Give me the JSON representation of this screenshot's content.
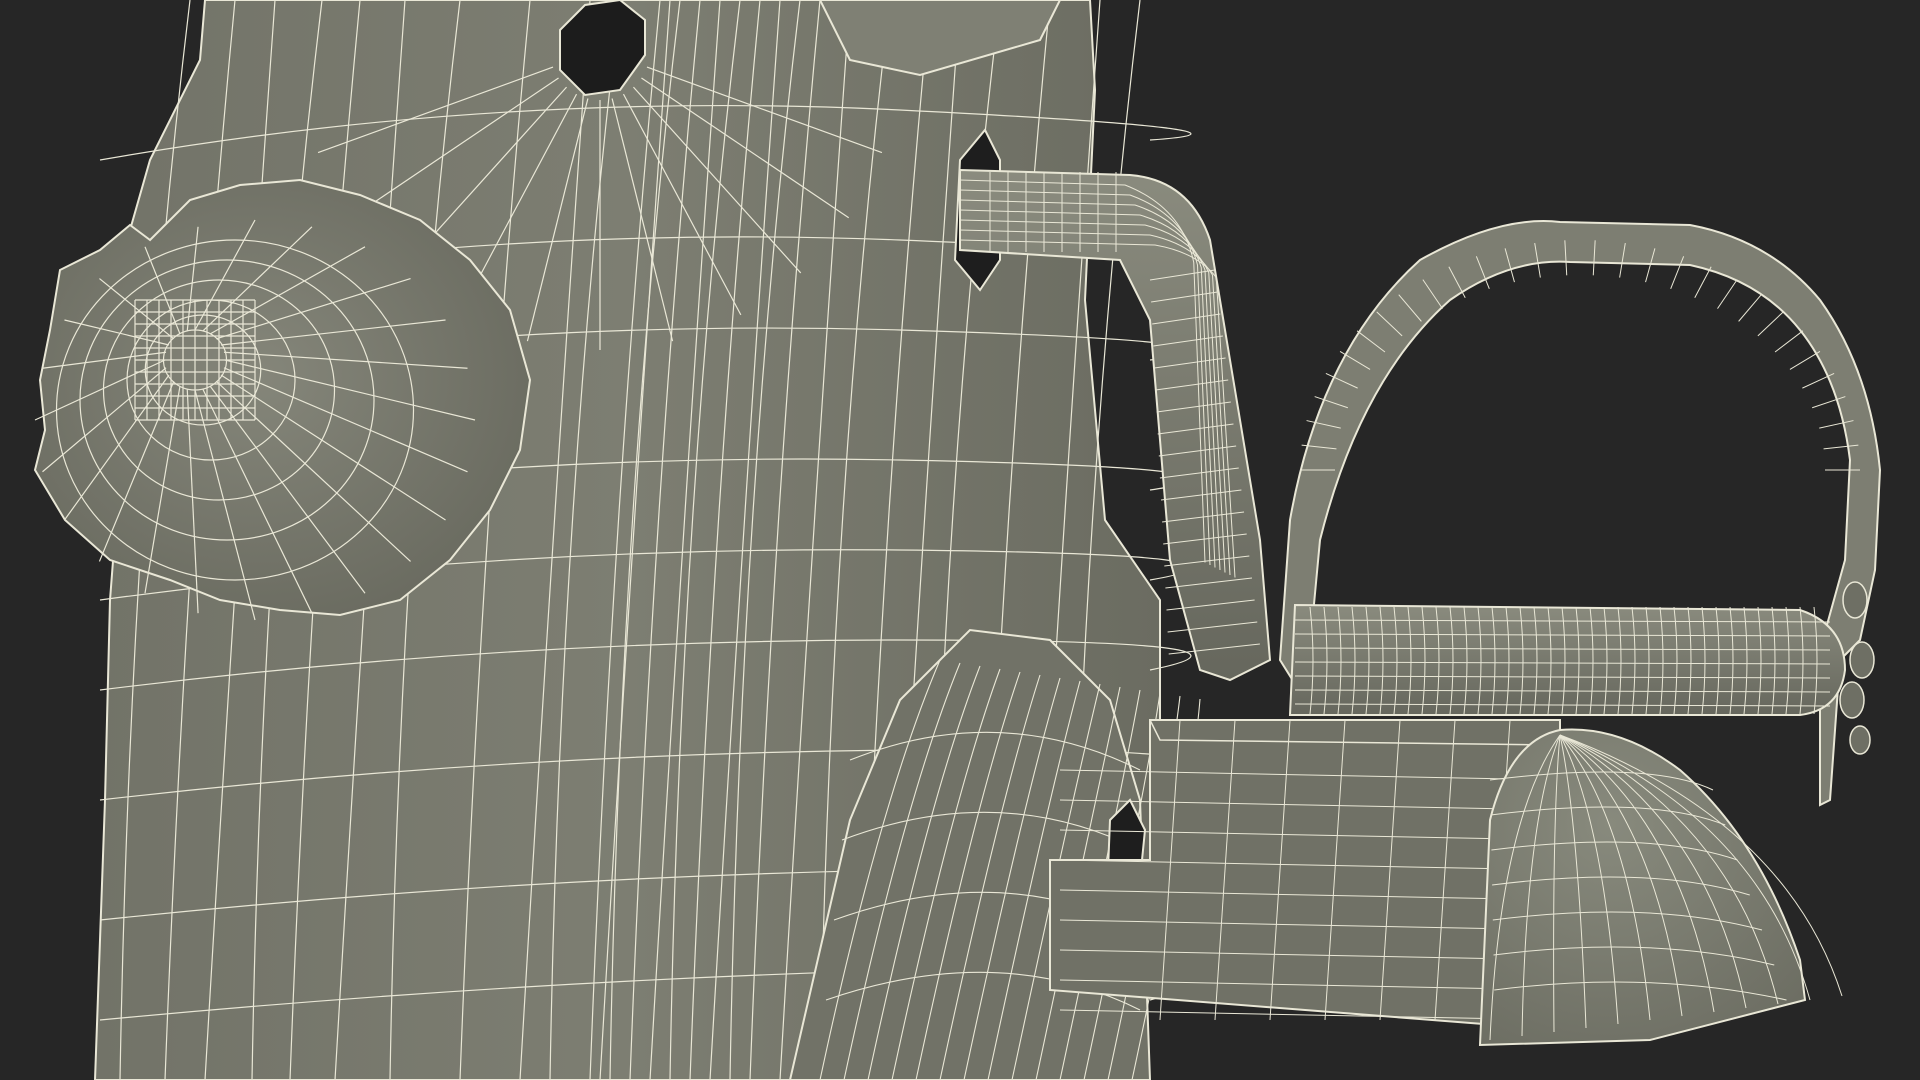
{
  "render": {
    "background": "#262626",
    "surface_fill": "#7b7c70",
    "surface_shadow": "#5f6056",
    "surface_highlight": "#8c8d80",
    "wire_color": "#e9e7d6",
    "hole_color": "#1c1c1c"
  },
  "objects": [
    {
      "name": "body-panel"
    },
    {
      "name": "adjustment-knob"
    },
    {
      "name": "crank-arm"
    },
    {
      "name": "pedal"
    },
    {
      "name": "base-bar"
    },
    {
      "name": "foot-cap"
    },
    {
      "name": "mount-hole"
    }
  ]
}
